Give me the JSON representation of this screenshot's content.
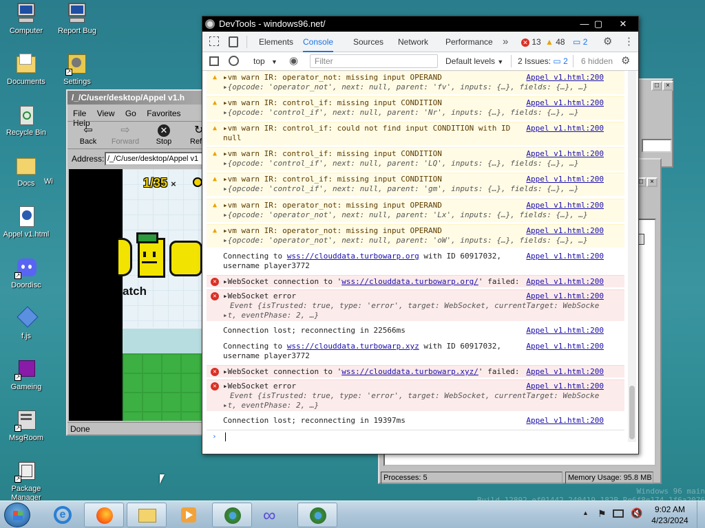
{
  "desktop": {
    "icons": [
      {
        "label": "Computer"
      },
      {
        "label": "Report Bug"
      },
      {
        "label": "Documents"
      },
      {
        "label": "Settings"
      },
      {
        "label": "Recycle Bin"
      },
      {
        "label": "Docs"
      },
      {
        "label": "Appel v1.html"
      },
      {
        "label": "Doordisc"
      },
      {
        "label": "f.js"
      },
      {
        "label": "Gameing"
      },
      {
        "label": "MsgRoom"
      },
      {
        "label": "Package Manager"
      }
    ],
    "partial_label": "Wi",
    "watermark": {
      "line1": "Windows 96 main",
      "line2": "Build 12892 ef01442 240419 182B Re6f8e174 1f6a2076"
    }
  },
  "browser": {
    "title": "/_/C/user/desktop/Appel v1.h",
    "menu": [
      "File",
      "View",
      "Go",
      "Favorites",
      "Help"
    ],
    "toolbar": {
      "back": "Back",
      "forward": "Forward",
      "stop": "Stop",
      "refresh": "Refr"
    },
    "address_label": "Address:",
    "address_value": "/_/C/user/desktop/Appel v1",
    "status": "Done",
    "game": {
      "counter": "1/35",
      "times": "×",
      "word": "atch"
    }
  },
  "taskmgr": {
    "processes": "Processes: 5",
    "memory": "Memory Usage: 95.8 MB"
  },
  "devtools": {
    "title": "DevTools - windows96.net/",
    "tabs": [
      "Elements",
      "Console",
      "Sources",
      "Network",
      "Performance"
    ],
    "more_tabs": "»",
    "err_count": "13",
    "warn_count": "48",
    "info_count": "2",
    "context": "top",
    "filter_placeholder": "Filter",
    "levels": "Default levels",
    "issues_label": "2 Issues:",
    "issues_count": "2",
    "hidden": "6 hidden",
    "source": "Appel v1.html:200",
    "messages": [
      {
        "type": "warn",
        "text": "vm warn IR: operator_not: missing input OPERAND",
        "sub": "{opcode: 'operator_not', next: null, parent: 'fv', inputs: {…}, fields: {…}, …}"
      },
      {
        "type": "warn",
        "text": "vm warn IR: control_if: missing input CONDITION",
        "sub": "{opcode: 'control_if', next: null, parent: 'Nr', inputs: {…}, fields: {…}, …}"
      },
      {
        "type": "warn",
        "text": "vm warn IR: control_if: could not find input CONDITION with ID",
        "sub": "null"
      },
      {
        "type": "warn",
        "text": "vm warn IR: control_if: missing input CONDITION",
        "sub": "{opcode: 'control_if', next: null, parent: 'LQ', inputs: {…}, fields: {…}, …}"
      },
      {
        "type": "warn",
        "text": "vm warn IR: control_if: missing input CONDITION",
        "sub": "{opcode: 'control_if', next: null, parent: 'gm', inputs: {…}, fields: {…}, …}"
      },
      {
        "type": "warn",
        "text": "vm warn IR: operator_not: missing input OPERAND",
        "sub": "{opcode: 'operator_not', next: null, parent: 'Lx', inputs: {…}, fields: {…}, …}"
      },
      {
        "type": "warn",
        "text": "vm warn IR: operator_not: missing input OPERAND",
        "sub": "{opcode: 'operator_not', next: null, parent: 'oW', inputs: {…}, fields: {…}, …}"
      },
      {
        "type": "log",
        "pre": "Connecting to ",
        "link": "wss://clouddata.turbowarp.org",
        "post": " with ID 60917032,",
        "sub": "username player3772"
      },
      {
        "type": "err",
        "pre": "WebSocket connection to '",
        "link": "wss://clouddata.turbowarp.org/",
        "post": "' failed:"
      },
      {
        "type": "err2",
        "text": "WebSocket error",
        "sub": "Event {isTrusted: true, type: 'error', target: WebSocket, currentTarget: WebSocke",
        "sub2": "t, eventPhase: 2, …}"
      },
      {
        "type": "log",
        "text": "Connection lost; reconnecting in 22566ms"
      },
      {
        "type": "log",
        "pre": "Connecting to ",
        "link": "wss://clouddata.turbowarp.xyz",
        "post": " with ID 60917032,",
        "sub": "username player3772"
      },
      {
        "type": "err",
        "pre": "WebSocket connection to '",
        "link": "wss://clouddata.turbowarp.xyz/",
        "post": "' failed:"
      },
      {
        "type": "err2",
        "text": "WebSocket error",
        "sub": "Event {isTrusted: true, type: 'error', target: WebSocket, currentTarget: WebSocke",
        "sub2": "t, eventPhase: 2, …}"
      },
      {
        "type": "log",
        "text": "Connection lost; reconnecting in 19397ms"
      }
    ],
    "prompt": "›"
  },
  "taskbar": {
    "time": "9:02 AM",
    "date": "4/23/2024"
  }
}
